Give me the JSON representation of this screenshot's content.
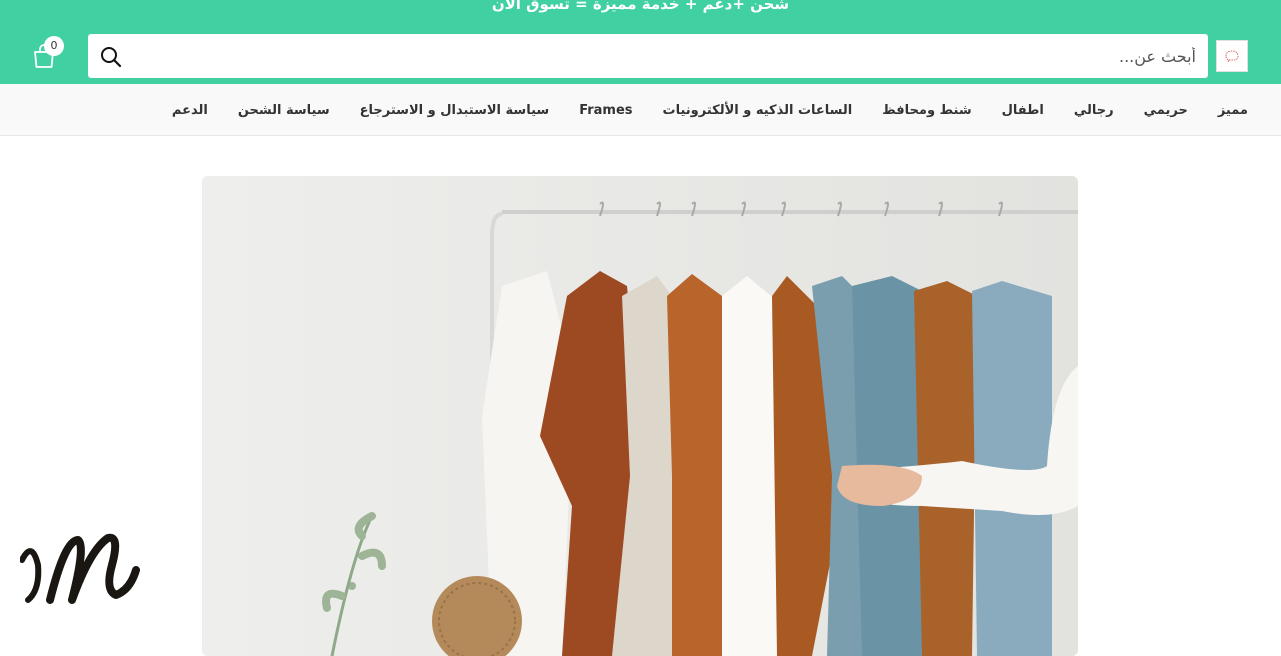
{
  "header": {
    "promo_text": "شحن +دعم + خدمة مميزة = تسوق الآن",
    "logo_icon": "brain-logo-icon",
    "cart_icon": "shopping-bag-icon",
    "cart_count": "0",
    "search_icon": "search-icon",
    "bg_color": "#41d0a2"
  },
  "search": {
    "placeholder": "أبحث عن..."
  },
  "nav": {
    "items": [
      {
        "label": "مميز"
      },
      {
        "label": "حريمي"
      },
      {
        "label": "رجالي"
      },
      {
        "label": "اطفال"
      },
      {
        "label": "شنط ومحافظ"
      },
      {
        "label": "الساعات الذكيه و الألكترونيات"
      },
      {
        "label": "Frames"
      },
      {
        "label": "سياسة الاستبدال و الاسترجاع"
      },
      {
        "label": "سياسة الشحن"
      },
      {
        "label": "الدعم"
      }
    ]
  }
}
